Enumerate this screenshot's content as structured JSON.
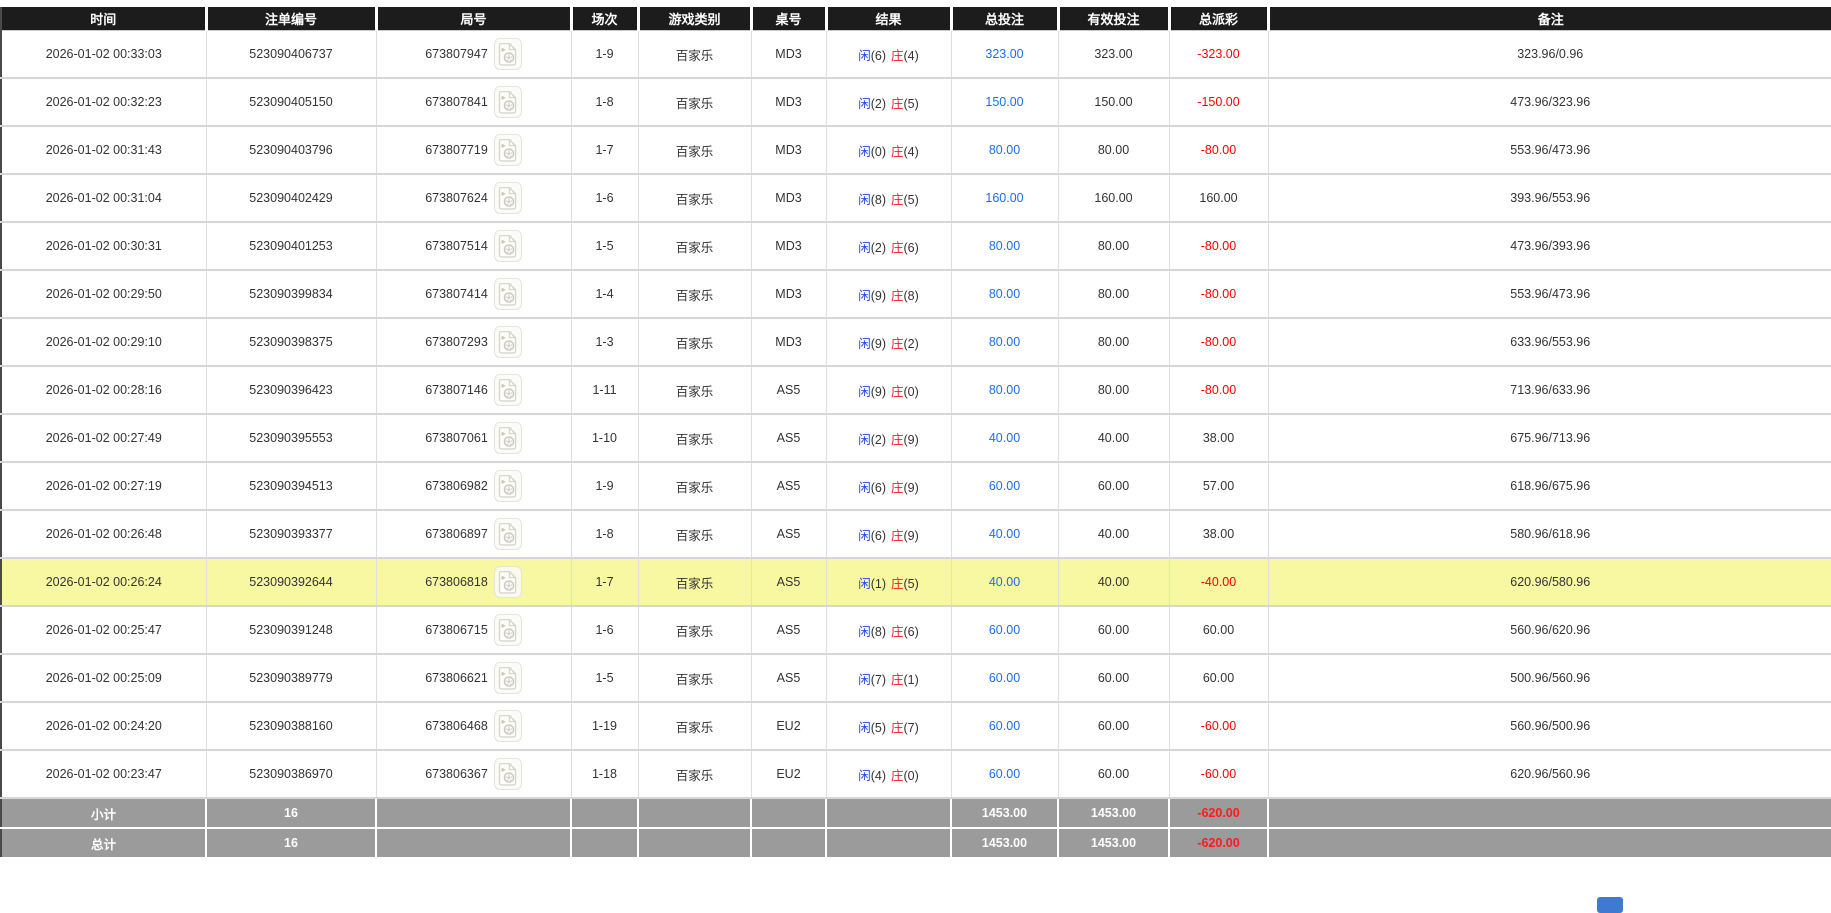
{
  "colors": {
    "header_bg": "#1c1c1c",
    "footer_bg": "#9b9b9b",
    "highlight_yellow": "#f8f8a2",
    "total_bet_blue": "#1c6fe8",
    "player_blue": "#2b43e6",
    "banker_red": "#e62222",
    "negative_red": "#ff0000",
    "pagination_blue": "#3f7ad0"
  },
  "table": {
    "columns": [
      {
        "key": "time",
        "label": "时间"
      },
      {
        "key": "bet_id",
        "label": "注单编号"
      },
      {
        "key": "round",
        "label": "局号"
      },
      {
        "key": "session",
        "label": "场次"
      },
      {
        "key": "game",
        "label": "游戏类别"
      },
      {
        "key": "table_no",
        "label": "桌号"
      },
      {
        "key": "result",
        "label": "结果"
      },
      {
        "key": "total_bet",
        "label": "总投注"
      },
      {
        "key": "valid_bet",
        "label": "有效投注"
      },
      {
        "key": "payout",
        "label": "总派彩"
      },
      {
        "key": "remark",
        "label": "备注"
      }
    ],
    "rows": [
      {
        "time": "2026-01-02 00:33:03",
        "bet_id": "523090406737",
        "round": "673807947",
        "session": "1-9",
        "game": "百家乐",
        "table_no": "MD3",
        "result": {
          "player": "闲",
          "player_n": "(6)",
          "banker": "庄",
          "banker_n": "(4)"
        },
        "total_bet": "323.00",
        "valid_bet": "323.00",
        "payout": "-323.00",
        "remark": "323.96/0.96",
        "highlighted": false
      },
      {
        "time": "2026-01-02 00:32:23",
        "bet_id": "523090405150",
        "round": "673807841",
        "session": "1-8",
        "game": "百家乐",
        "table_no": "MD3",
        "result": {
          "player": "闲",
          "player_n": "(2)",
          "banker": "庄",
          "banker_n": "(5)"
        },
        "total_bet": "150.00",
        "valid_bet": "150.00",
        "payout": "-150.00",
        "remark": "473.96/323.96",
        "highlighted": false
      },
      {
        "time": "2026-01-02 00:31:43",
        "bet_id": "523090403796",
        "round": "673807719",
        "session": "1-7",
        "game": "百家乐",
        "table_no": "MD3",
        "result": {
          "player": "闲",
          "player_n": "(0)",
          "banker": "庄",
          "banker_n": "(4)"
        },
        "total_bet": "80.00",
        "valid_bet": "80.00",
        "payout": "-80.00",
        "remark": "553.96/473.96",
        "highlighted": false
      },
      {
        "time": "2026-01-02 00:31:04",
        "bet_id": "523090402429",
        "round": "673807624",
        "session": "1-6",
        "game": "百家乐",
        "table_no": "MD3",
        "result": {
          "player": "闲",
          "player_n": "(8)",
          "banker": "庄",
          "banker_n": "(5)"
        },
        "total_bet": "160.00",
        "valid_bet": "160.00",
        "payout": "160.00",
        "remark": "393.96/553.96",
        "highlighted": false
      },
      {
        "time": "2026-01-02 00:30:31",
        "bet_id": "523090401253",
        "round": "673807514",
        "session": "1-5",
        "game": "百家乐",
        "table_no": "MD3",
        "result": {
          "player": "闲",
          "player_n": "(2)",
          "banker": "庄",
          "banker_n": "(6)"
        },
        "total_bet": "80.00",
        "valid_bet": "80.00",
        "payout": "-80.00",
        "remark": "473.96/393.96",
        "highlighted": false
      },
      {
        "time": "2026-01-02 00:29:50",
        "bet_id": "523090399834",
        "round": "673807414",
        "session": "1-4",
        "game": "百家乐",
        "table_no": "MD3",
        "result": {
          "player": "闲",
          "player_n": "(9)",
          "banker": "庄",
          "banker_n": "(8)"
        },
        "total_bet": "80.00",
        "valid_bet": "80.00",
        "payout": "-80.00",
        "remark": "553.96/473.96",
        "highlighted": false
      },
      {
        "time": "2026-01-02 00:29:10",
        "bet_id": "523090398375",
        "round": "673807293",
        "session": "1-3",
        "game": "百家乐",
        "table_no": "MD3",
        "result": {
          "player": "闲",
          "player_n": "(9)",
          "banker": "庄",
          "banker_n": "(2)"
        },
        "total_bet": "80.00",
        "valid_bet": "80.00",
        "payout": "-80.00",
        "remark": "633.96/553.96",
        "highlighted": false
      },
      {
        "time": "2026-01-02 00:28:16",
        "bet_id": "523090396423",
        "round": "673807146",
        "session": "1-11",
        "game": "百家乐",
        "table_no": "AS5",
        "result": {
          "player": "闲",
          "player_n": "(9)",
          "banker": "庄",
          "banker_n": "(0)"
        },
        "total_bet": "80.00",
        "valid_bet": "80.00",
        "payout": "-80.00",
        "remark": "713.96/633.96",
        "highlighted": false
      },
      {
        "time": "2026-01-02 00:27:49",
        "bet_id": "523090395553",
        "round": "673807061",
        "session": "1-10",
        "game": "百家乐",
        "table_no": "AS5",
        "result": {
          "player": "闲",
          "player_n": "(2)",
          "banker": "庄",
          "banker_n": "(9)"
        },
        "total_bet": "40.00",
        "valid_bet": "40.00",
        "payout": "38.00",
        "remark": "675.96/713.96",
        "highlighted": false
      },
      {
        "time": "2026-01-02 00:27:19",
        "bet_id": "523090394513",
        "round": "673806982",
        "session": "1-9",
        "game": "百家乐",
        "table_no": "AS5",
        "result": {
          "player": "闲",
          "player_n": "(6)",
          "banker": "庄",
          "banker_n": "(9)"
        },
        "total_bet": "60.00",
        "valid_bet": "60.00",
        "payout": "57.00",
        "remark": "618.96/675.96",
        "highlighted": false
      },
      {
        "time": "2026-01-02 00:26:48",
        "bet_id": "523090393377",
        "round": "673806897",
        "session": "1-8",
        "game": "百家乐",
        "table_no": "AS5",
        "result": {
          "player": "闲",
          "player_n": "(6)",
          "banker": "庄",
          "banker_n": "(9)"
        },
        "total_bet": "40.00",
        "valid_bet": "40.00",
        "payout": "38.00",
        "remark": "580.96/618.96",
        "highlighted": false
      },
      {
        "time": "2026-01-02 00:26:24",
        "bet_id": "523090392644",
        "round": "673806818",
        "session": "1-7",
        "game": "百家乐",
        "table_no": "AS5",
        "result": {
          "player": "闲",
          "player_n": "(1)",
          "banker": "庄",
          "banker_n": "(5)"
        },
        "total_bet": "40.00",
        "valid_bet": "40.00",
        "payout": "-40.00",
        "remark": "620.96/580.96",
        "highlighted": true
      },
      {
        "time": "2026-01-02 00:25:47",
        "bet_id": "523090391248",
        "round": "673806715",
        "session": "1-6",
        "game": "百家乐",
        "table_no": "AS5",
        "result": {
          "player": "闲",
          "player_n": "(8)",
          "banker": "庄",
          "banker_n": "(6)"
        },
        "total_bet": "60.00",
        "valid_bet": "60.00",
        "payout": "60.00",
        "remark": "560.96/620.96",
        "highlighted": false
      },
      {
        "time": "2026-01-02 00:25:09",
        "bet_id": "523090389779",
        "round": "673806621",
        "session": "1-5",
        "game": "百家乐",
        "table_no": "AS5",
        "result": {
          "player": "闲",
          "player_n": "(7)",
          "banker": "庄",
          "banker_n": "(1)"
        },
        "total_bet": "60.00",
        "valid_bet": "60.00",
        "payout": "60.00",
        "remark": "500.96/560.96",
        "highlighted": false
      },
      {
        "time": "2026-01-02 00:24:20",
        "bet_id": "523090388160",
        "round": "673806468",
        "session": "1-19",
        "game": "百家乐",
        "table_no": "EU2",
        "result": {
          "player": "闲",
          "player_n": "(5)",
          "banker": "庄",
          "banker_n": "(7)"
        },
        "total_bet": "60.00",
        "valid_bet": "60.00",
        "payout": "-60.00",
        "remark": "560.96/500.96",
        "highlighted": false
      },
      {
        "time": "2026-01-02 00:23:47",
        "bet_id": "523090386970",
        "round": "673806367",
        "session": "1-18",
        "game": "百家乐",
        "table_no": "EU2",
        "result": {
          "player": "闲",
          "player_n": "(4)",
          "banker": "庄",
          "banker_n": "(0)"
        },
        "total_bet": "60.00",
        "valid_bet": "60.00",
        "payout": "-60.00",
        "remark": "620.96/560.96",
        "highlighted": false
      }
    ],
    "footer_rows": [
      {
        "label": "小计",
        "count": "16",
        "total_bet": "1453.00",
        "valid_bet": "1453.00",
        "payout": "-620.00"
      },
      {
        "label": "总计",
        "count": "16",
        "total_bet": "1453.00",
        "valid_bet": "1453.00",
        "payout": "-620.00"
      }
    ]
  }
}
